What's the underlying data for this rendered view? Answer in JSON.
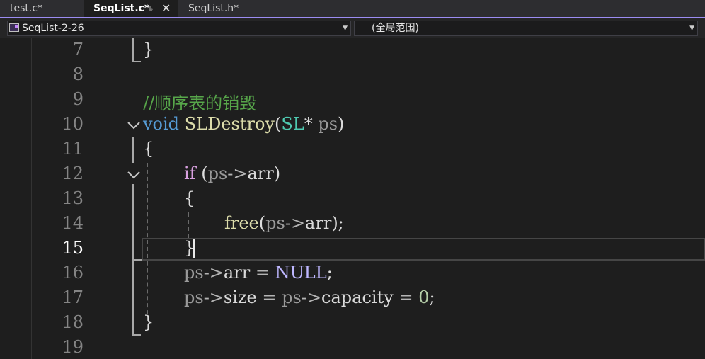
{
  "tabs": [
    {
      "label": "test.c*",
      "active": false
    },
    {
      "label": "SeqList.c*",
      "active": true,
      "pin_icon": "pin-icon",
      "close_icon": "close-icon"
    },
    {
      "label": "SeqList.h*",
      "active": false
    }
  ],
  "navbar": {
    "project": "SeqList-2-26",
    "scope": "(全局范围)"
  },
  "editor": {
    "current_line": 15,
    "line_numbers": [
      "7",
      "8",
      "9",
      "10",
      "11",
      "12",
      "13",
      "14",
      "15",
      "16",
      "17",
      "18",
      "19"
    ],
    "code": {
      "l7_brace": "}",
      "l9_comment": "//顺序表的销毁",
      "l10_kw": "void",
      "l10_fn": "SLDestroy",
      "l10_lp": "(",
      "l10_type": "SL",
      "l10_star": "*",
      "l10_param": "ps",
      "l10_rp": ")",
      "l11_brace": "{",
      "l12_kw": "if",
      "l12_lp": "(",
      "l12_ps": "ps",
      "l12_arrow": "->",
      "l12_member": "arr",
      "l12_rp": ")",
      "l13_brace": "{",
      "l14_fn": "free",
      "l14_lp": "(",
      "l14_ps": "ps",
      "l14_arrow": "->",
      "l14_member": "arr",
      "l14_end": ");",
      "l15_brace": "}",
      "l16_ps": "ps",
      "l16_arrow": "->",
      "l16_member": "arr",
      "l16_eq": "=",
      "l16_null": "NULL",
      "l16_semi": ";",
      "l17_ps": "ps",
      "l17_arrow": "->",
      "l17_member": "size",
      "l17_eq": "=",
      "l17_ps2": "ps",
      "l17_arrow2": "->",
      "l17_member2": "capacity",
      "l17_eq2": "=",
      "l17_zero": "0",
      "l17_semi": ";",
      "l18_brace": "}"
    }
  },
  "colors": {
    "accent": "#9b8cf2",
    "keyword": "#569cd6",
    "control": "#d8a0df",
    "function": "#dcdcaa",
    "type": "#4ec9b0",
    "comment": "#57a64a",
    "macro": "#beb7ff",
    "number": "#b5cea8"
  }
}
